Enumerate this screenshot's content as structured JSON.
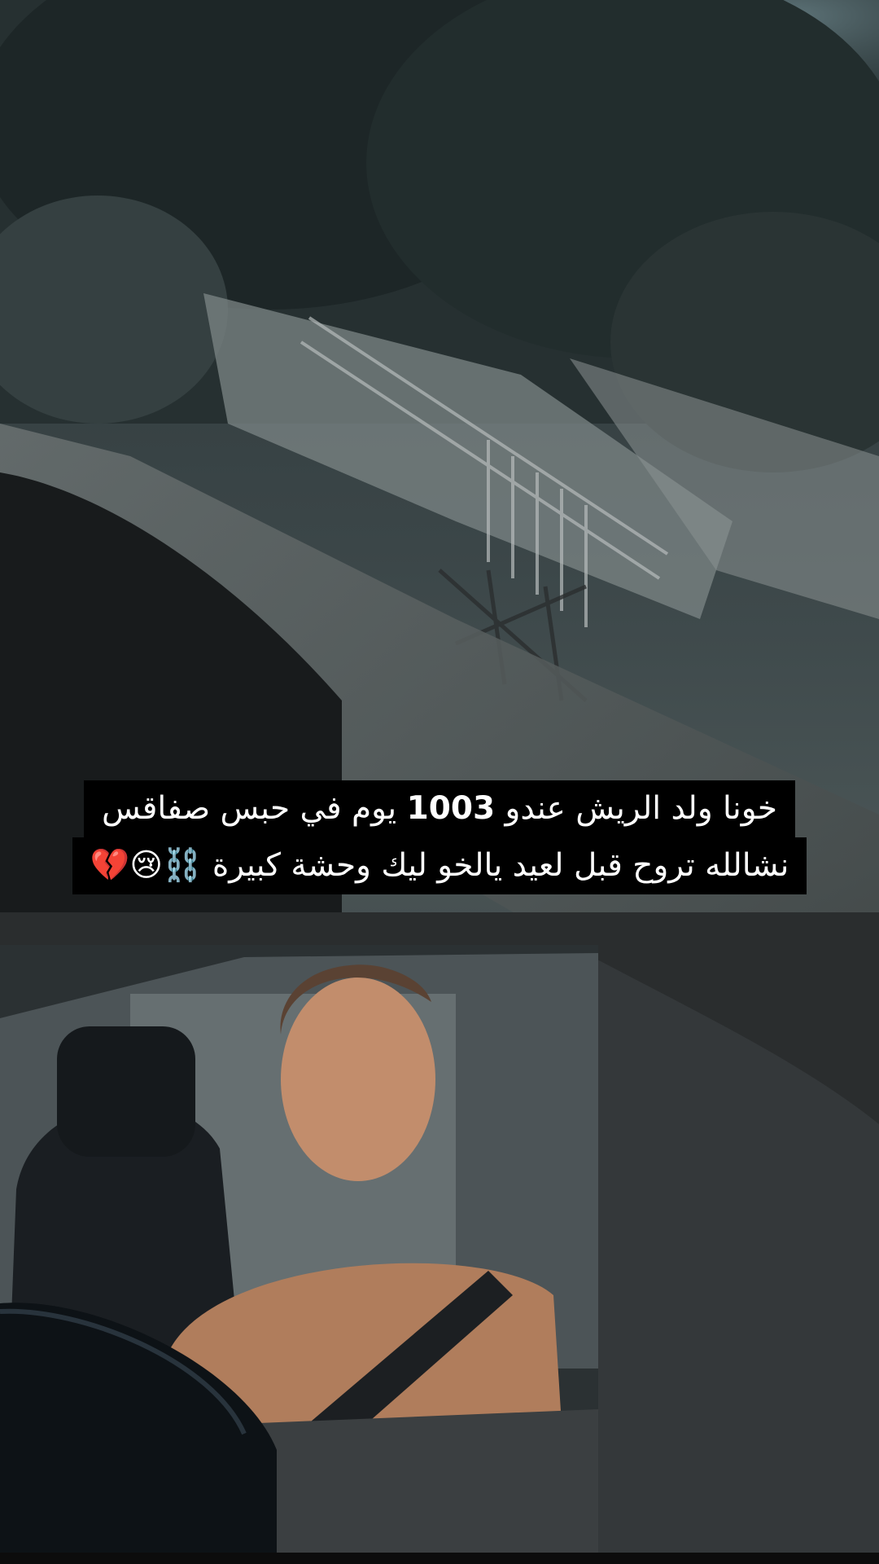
{
  "caption": {
    "line1_after": "خونا ولد الريش عندو",
    "line1_number": "1003",
    "line1_before": "يوم في حبس صفاقس",
    "line2": "نشالله تروح قبل لعيد يالخو ليك وحشة كبيرة",
    "line2_emojis": "⛓️😢💔"
  },
  "colors": {
    "caption_bg": "#000000",
    "caption_text": "#ffffff"
  }
}
